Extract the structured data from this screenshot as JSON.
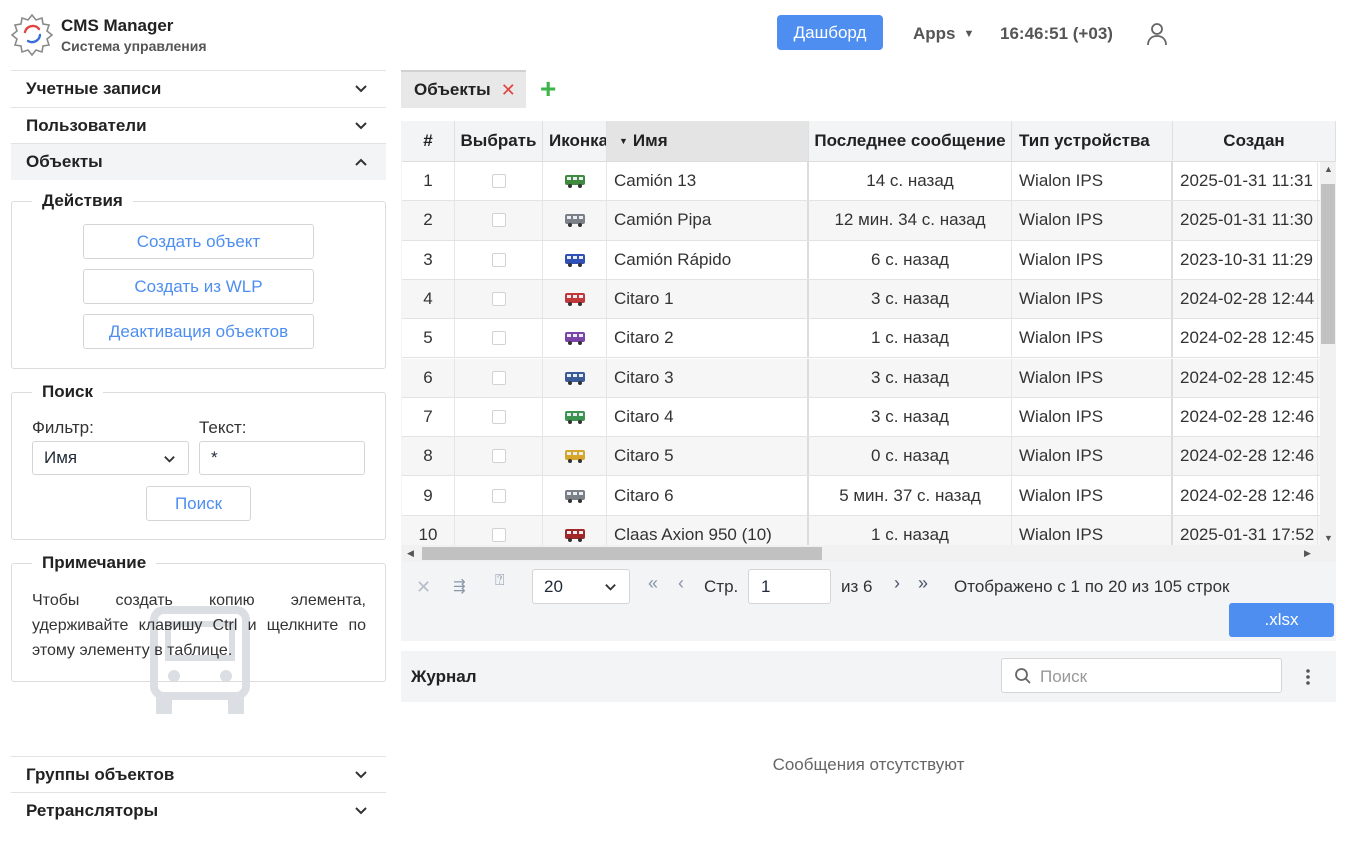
{
  "header": {
    "app_title": "CMS Manager",
    "app_subtitle": "Система управления",
    "dashboard_label": "Дашборд",
    "apps_label": "Apps",
    "clock": "16:46:51 (+03)"
  },
  "sidebar": {
    "sections_top": [
      {
        "label": "Учетные записи"
      },
      {
        "label": "Пользователи"
      },
      {
        "label": "Объекты"
      }
    ],
    "actions": {
      "legend": "Действия",
      "buttons": [
        "Создать объект",
        "Создать из WLP",
        "Деактивация объектов"
      ]
    },
    "search": {
      "legend": "Поиск",
      "filter_label": "Фильтр:",
      "text_label": "Текст:",
      "filter_value": "Имя",
      "text_value": "*",
      "button": "Поиск"
    },
    "note": {
      "legend": "Примечание",
      "text": "Чтобы создать копию элемента, удерживайте клавишу Ctrl и щелкните по этому элементу в таблице."
    },
    "sections_bottom": [
      {
        "label": "Группы объектов"
      },
      {
        "label": "Ретрансляторы"
      }
    ]
  },
  "tabs": [
    {
      "label": "Объекты"
    }
  ],
  "table": {
    "headers": [
      "#",
      "Выбрать",
      "Иконка",
      "Имя",
      "Последнее сообщение",
      "Тип устройства",
      "Создан"
    ],
    "rows": [
      {
        "num": "1",
        "icon": "truck-green-icon",
        "name": "Camión 13",
        "msg": "14 с. назад",
        "type": "Wialon IPS",
        "created": "2025-01-31 11:31"
      },
      {
        "num": "2",
        "icon": "bus-grey-icon",
        "name": "Camión Pipa",
        "msg": "12 мин. 34 с. назад",
        "type": "Wialon IPS",
        "created": "2025-01-31 11:30"
      },
      {
        "num": "3",
        "icon": "truck-blue-icon",
        "name": "Camión Rápido",
        "msg": "6 с. назад",
        "type": "Wialon IPS",
        "created": "2023-10-31 11:29"
      },
      {
        "num": "4",
        "icon": "bus-red-icon",
        "name": "Citaro 1",
        "msg": "3 с. назад",
        "type": "Wialon IPS",
        "created": "2024-02-28 12:44"
      },
      {
        "num": "5",
        "icon": "bus-purple-icon",
        "name": "Citaro 2",
        "msg": "1 с. назад",
        "type": "Wialon IPS",
        "created": "2024-02-28 12:45"
      },
      {
        "num": "6",
        "icon": "bus-blue-icon",
        "name": "Citaro 3",
        "msg": "3 с. назад",
        "type": "Wialon IPS",
        "created": "2024-02-28 12:45"
      },
      {
        "num": "7",
        "icon": "bus-green-icon",
        "name": "Citaro 4",
        "msg": "3 с. назад",
        "type": "Wialon IPS",
        "created": "2024-02-28 12:46"
      },
      {
        "num": "8",
        "icon": "bus-yellow-icon",
        "name": "Citaro 5",
        "msg": "0 с. назад",
        "type": "Wialon IPS",
        "created": "2024-02-28 12:46"
      },
      {
        "num": "9",
        "icon": "bus-grey-icon",
        "name": "Citaro 6",
        "msg": "5 мин. 37 с. назад",
        "type": "Wialon IPS",
        "created": "2024-02-28 12:46"
      },
      {
        "num": "10",
        "icon": "tractor-red-icon",
        "name": "Claas Axion 950 (10)",
        "msg": "1 с. назад",
        "type": "Wialon IPS",
        "created": "2025-01-31 17:52"
      }
    ]
  },
  "pager": {
    "page_size": "20",
    "page_label": "Стр.",
    "page_value": "1",
    "of_label": "из 6",
    "summary": "Отображено с 1 по 20 из 105 строк",
    "export_label": ".xlsx"
  },
  "journal": {
    "title": "Журнал",
    "search_placeholder": "Поиск",
    "empty_message": "Сообщения отсутствуют"
  },
  "colors": {
    "accent": "#4d8ef0",
    "add_green": "#3bb54a",
    "close_red": "#e24444"
  }
}
